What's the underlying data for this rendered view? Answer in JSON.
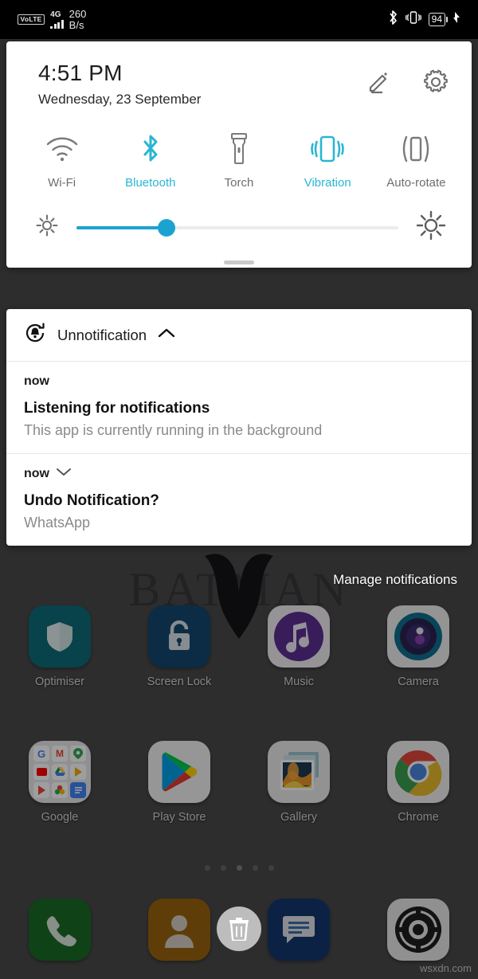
{
  "status_bar": {
    "volte_label": "VoLTE",
    "network_type": "4G",
    "data_speed_value": "260",
    "data_speed_unit": "B/s",
    "bluetooth_icon": "bluetooth-icon",
    "vibrate_icon": "vibrate-icon",
    "battery_level": "94",
    "charging_icon": "charging-bolt-icon"
  },
  "quick_settings": {
    "clock": "4:51 PM",
    "date": "Wednesday, 23 September",
    "edit_icon": "pencil-edit-icon",
    "settings_icon": "gear-icon",
    "accent_color": "#29b6d4",
    "inactive_color": "#6d6d6d",
    "toggles": [
      {
        "label": "Wi-Fi",
        "icon": "wifi-icon",
        "active": false
      },
      {
        "label": "Bluetooth",
        "icon": "bluetooth-icon",
        "active": true
      },
      {
        "label": "Torch",
        "icon": "flashlight-icon",
        "active": false
      },
      {
        "label": "Vibration",
        "icon": "vibration-icon",
        "active": true
      },
      {
        "label": "Auto-rotate",
        "icon": "auto-rotate-icon",
        "active": false
      }
    ],
    "brightness": {
      "low_icon": "brightness-low-icon",
      "high_icon": "brightness-high-icon",
      "percent": 28
    },
    "drag_handle": "panel-drag-handle"
  },
  "notification_shade": {
    "group": {
      "app_icon": "unnotification-bell-restore-icon",
      "app_name": "Unnotification",
      "collapse_icon": "chevron-up-icon"
    },
    "notifications": [
      {
        "time": "now",
        "expand_icon": "",
        "title": "Listening for notifications",
        "body": "This app is currently running in the background"
      },
      {
        "time": "now",
        "expand_icon": "chevron-down-icon",
        "title": "Undo Notification?",
        "body": "WhatsApp"
      }
    ],
    "manage_label": "Manage notifications"
  },
  "home_screen": {
    "wallpaper_text": "BATMAN",
    "app_rows": [
      [
        {
          "label": "Optimiser",
          "icon": "shield-optimiser-icon"
        },
        {
          "label": "Screen Lock",
          "icon": "padlock-icon"
        },
        {
          "label": "Music",
          "icon": "music-note-icon"
        },
        {
          "label": "Camera",
          "icon": "camera-lens-icon"
        }
      ],
      [
        {
          "label": "Google",
          "icon": "google-folder-icon"
        },
        {
          "label": "Play Store",
          "icon": "play-store-icon"
        },
        {
          "label": "Gallery",
          "icon": "gallery-photos-icon"
        },
        {
          "label": "Chrome",
          "icon": "chrome-icon"
        }
      ]
    ],
    "dock": [
      {
        "label": "",
        "icon": "phone-dialer-icon"
      },
      {
        "label": "",
        "icon": "contacts-icon"
      },
      {
        "label": "",
        "icon": "messages-icon"
      },
      {
        "label": "",
        "icon": "settings-gear-icon"
      }
    ],
    "trash_button": "delete-trash-icon",
    "page_dots": 5,
    "active_dot": 2
  },
  "watermark": "wsxdn.com"
}
